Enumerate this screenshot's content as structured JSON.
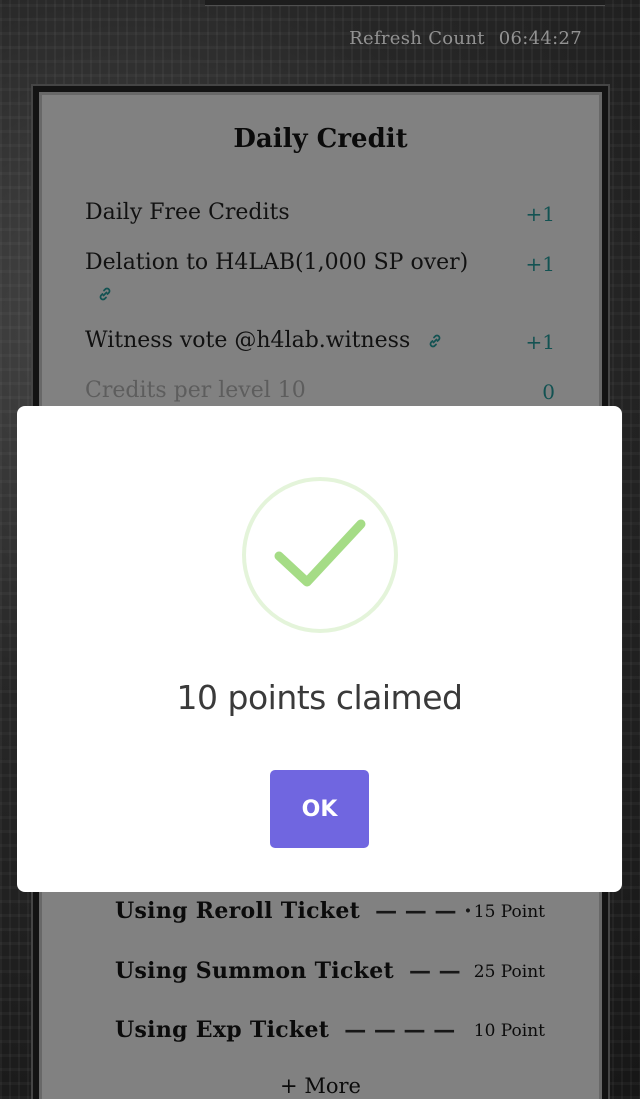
{
  "header": {
    "refresh_label": "Refresh Count",
    "countdown": "06:44:27"
  },
  "card": {
    "title": "Daily Credit",
    "rows": [
      {
        "label": "Daily Free Credits",
        "value": "+1"
      },
      {
        "label": "Delation to H4LAB(1,000 SP over)",
        "value": "+1",
        "link_icon": "link-icon"
      },
      {
        "label": "Witness vote @h4lab.witness",
        "value": "+1",
        "link_icon": "link-icon"
      },
      {
        "label": "Credits per level 10",
        "value": "0"
      }
    ],
    "point_rows": [
      {
        "label": "Using Reroll Ticket",
        "dash": "— — — ·",
        "points": "15 Point"
      },
      {
        "label": "Using Summon Ticket",
        "dash": "— —",
        "points": "25 Point"
      },
      {
        "label": "Using Exp Ticket",
        "dash": "— — — —",
        "points": "10 Point"
      }
    ],
    "more_label": "+ More"
  },
  "modal": {
    "icon": "success-check-icon",
    "message": "10 points claimed",
    "ok_label": "OK"
  },
  "colors": {
    "accent": "#7066e0",
    "success": "#a5dc86",
    "credit_value": "#1d7a7a"
  }
}
